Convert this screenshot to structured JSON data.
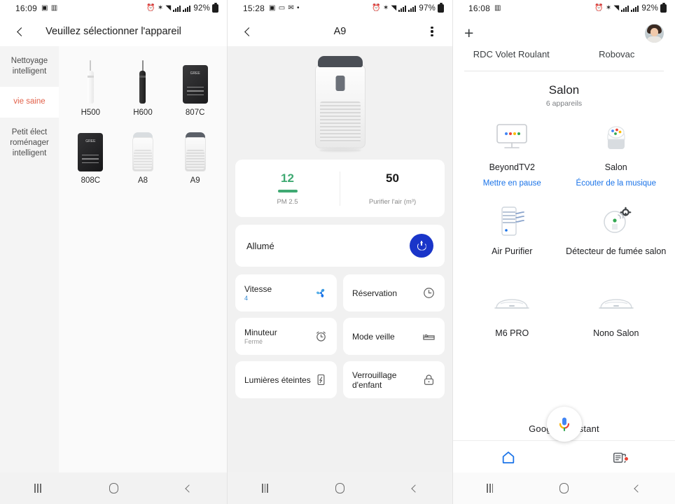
{
  "screen1": {
    "status": {
      "time": "16:09",
      "battery": "92%",
      "icons": [
        "image-icon",
        "vibrate-icon"
      ],
      "right_icons": [
        "alarm-icon",
        "bluetooth-icon",
        "wifi-icon",
        "signal-icon",
        "signal-icon"
      ]
    },
    "appbar": {
      "back": "back-icon",
      "title": "Veuillez sélectionner l'appareil"
    },
    "categories": [
      {
        "label": "Nettoyage intelligent",
        "active": false
      },
      {
        "label": "vie saine",
        "active": true
      },
      {
        "label": "Petit élect roménager intelligent",
        "active": false
      }
    ],
    "devices": [
      {
        "name": "H500",
        "art": "stick-white"
      },
      {
        "name": "H600",
        "art": "stick-black"
      },
      {
        "name": "807C",
        "art": "box-black"
      },
      {
        "name": "808C",
        "art": "box-black"
      },
      {
        "name": "A8",
        "art": "cyl-white"
      },
      {
        "name": "A9",
        "art": "cyl-grey"
      }
    ]
  },
  "screen2": {
    "status": {
      "time": "15:28",
      "battery": "97%",
      "icons": [
        "image-icon",
        "screen-icon",
        "mail-icon",
        "dot-icon"
      ]
    },
    "appbar": {
      "back": "back-icon",
      "title": "A9",
      "menu": "more-options-icon"
    },
    "stats": [
      {
        "value": "12",
        "label": "PM 2.5",
        "color": "#3fa972",
        "has_bar": true
      },
      {
        "value": "50",
        "label": "Purifier l'air (m³)",
        "color": "#1a1a1a",
        "has_bar": false
      }
    ],
    "power": {
      "label": "Allumé",
      "color": "#1a35c9",
      "icon": "power-icon"
    },
    "tiles": [
      {
        "label": "Vitesse",
        "sub": "4",
        "sub_accent": true,
        "icon": "fan-speed-icon"
      },
      {
        "label": "Réservation",
        "sub": "",
        "sub_accent": false,
        "icon": "clock-icon"
      },
      {
        "label": "Minuteur",
        "sub": "Fermé",
        "sub_accent": false,
        "icon": "alarm-clock-icon"
      },
      {
        "label": "Mode veille",
        "sub": "",
        "sub_accent": false,
        "icon": "bed-icon"
      },
      {
        "label": "Lumières éteintes",
        "sub": "",
        "sub_accent": false,
        "icon": "display-off-icon"
      },
      {
        "label": "Verrouillage d'enfant",
        "sub": "",
        "sub_accent": false,
        "icon": "child-lock-icon"
      }
    ]
  },
  "screen3": {
    "status": {
      "time": "16:08",
      "battery": "92%",
      "icons": [
        "vibrate-icon"
      ]
    },
    "topbar": {
      "add": "plus-icon",
      "avatar": "user-avatar"
    },
    "shortcuts": [
      {
        "label": "RDC Volet Roulant"
      },
      {
        "label": "Robovac"
      }
    ],
    "room": {
      "title": "Salon",
      "subtitle": "6 appareils"
    },
    "devices": [
      {
        "name": "BeyondTV2",
        "action": "Mettre en pause",
        "icon": "tv-icon"
      },
      {
        "name": "Salon",
        "action": "Écouter de la musique",
        "icon": "speaker-icon"
      },
      {
        "name": "Air Purifier",
        "action": "",
        "icon": "air-purifier-icon"
      },
      {
        "name": "Détecteur de fumée salon",
        "action": "",
        "icon": "smoke-detector-icon"
      },
      {
        "name": "M6 PRO",
        "action": "",
        "icon": "robot-vacuum-icon"
      },
      {
        "name": "Nono Salon",
        "action": "",
        "icon": "robot-vacuum-icon"
      }
    ],
    "assistant": {
      "text": "Google Assistant",
      "mic": "microphone-icon"
    },
    "bottom_nav": [
      {
        "icon": "home-icon",
        "active": true
      },
      {
        "icon": "feed-icon",
        "active": false,
        "badge": true
      }
    ]
  },
  "sysnav": {
    "recents": "recents-icon",
    "home": "home-icon",
    "back": "back-icon"
  }
}
